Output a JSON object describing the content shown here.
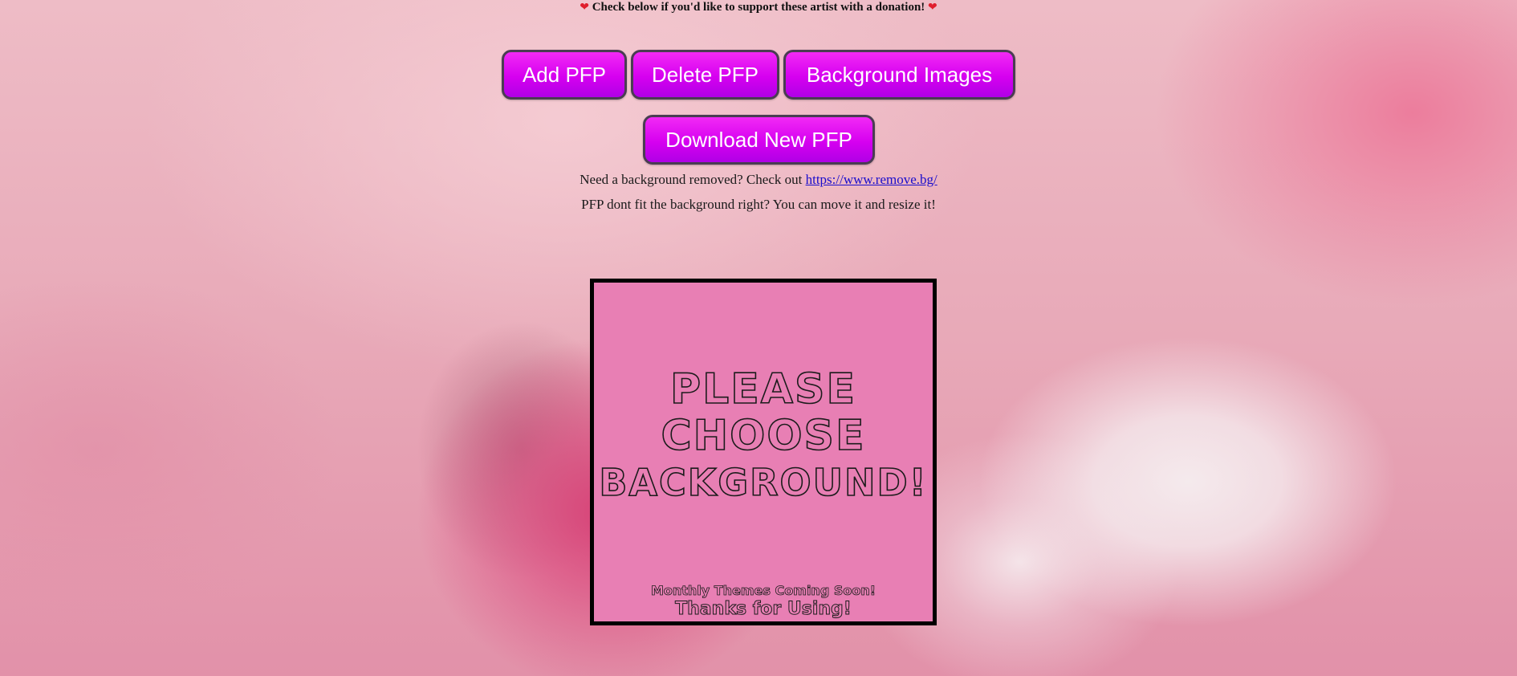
{
  "donation_banner": {
    "heart_left": "❤",
    "text": "Check below if you'd like to support these artist with a donation!",
    "heart_right": "❤"
  },
  "buttons": {
    "add_pfp": "Add PFP",
    "delete_pfp": "Delete PFP",
    "background_images": "Background Images",
    "download_new_pfp": "Download New PFP"
  },
  "info": {
    "bg_removed_prefix": "Need a background removed? Check out ",
    "bg_removed_link": "https://www.remove.bg/",
    "pfp_fit_text": "PFP dont fit the background right? You can move it and resize it!"
  },
  "canvas": {
    "title_line1": "PLEASE",
    "title_line2": "CHOOSE",
    "title_line3": "BACKGROUND!",
    "monthly_themes": "Monthly Themes Coming Soon!",
    "thanks": "Thanks for Using!"
  },
  "colors": {
    "button_fill": "#d600f0",
    "button_border": "#4a3d52",
    "canvas_fill": "#e87fb4",
    "heart": "#e01e2d",
    "link": "#1a0dcc"
  }
}
